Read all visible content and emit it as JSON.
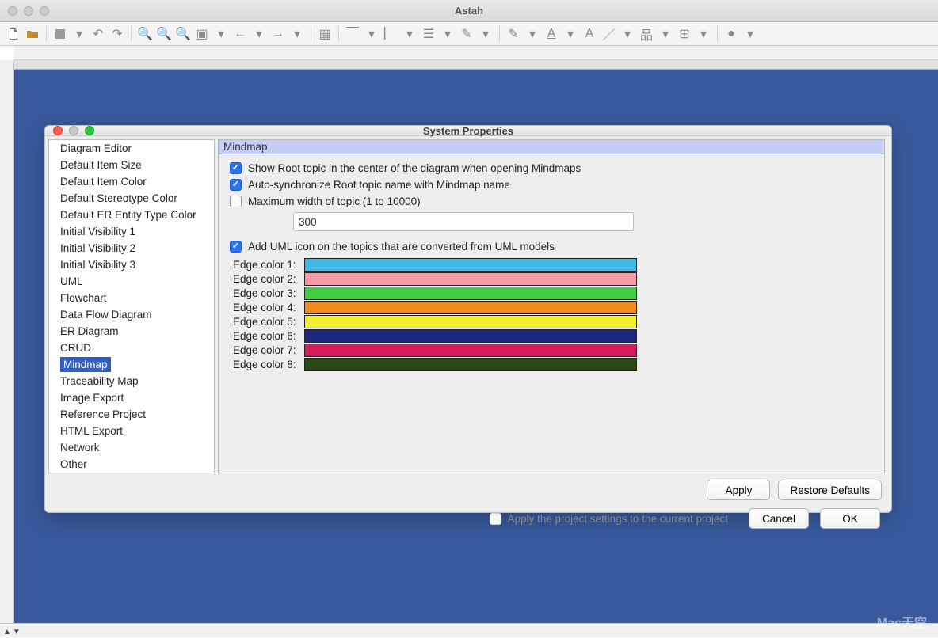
{
  "app": {
    "title": "Astah"
  },
  "dialog": {
    "title": "System Properties",
    "sidebar": {
      "items": [
        "Diagram Editor",
        "Default Item Size",
        "Default Item Color",
        "Default Stereotype Color",
        "Default ER Entity Type Color",
        "Initial Visibility 1",
        "Initial Visibility 2",
        "Initial Visibility 3",
        "UML",
        "Flowchart",
        "Data Flow Diagram",
        "ER Diagram",
        "CRUD",
        "Mindmap",
        "Traceability Map",
        "Image Export",
        "Reference Project",
        "HTML Export",
        "Network",
        "Other"
      ],
      "selected_index": 13
    },
    "content": {
      "header": "Mindmap",
      "opt_show_root": {
        "checked": true,
        "label": "Show Root topic in the center of the diagram when opening Mindmaps"
      },
      "opt_autosync": {
        "checked": true,
        "label": "Auto-synchronize Root topic name with Mindmap name"
      },
      "opt_maxwidth": {
        "checked": false,
        "label": "Maximum width of topic (1 to 10000)",
        "value": "300"
      },
      "opt_umlicon": {
        "checked": true,
        "label": "Add UML icon on the topics that are converted from UML models"
      },
      "edge_colors": [
        {
          "label": "Edge color 1:",
          "color": "#3fb8e8"
        },
        {
          "label": "Edge color 2:",
          "color": "#f59aa4"
        },
        {
          "label": "Edge color 3:",
          "color": "#3fcc3f"
        },
        {
          "label": "Edge color 4:",
          "color": "#f08a1e"
        },
        {
          "label": "Edge color 5:",
          "color": "#f2ef2f"
        },
        {
          "label": "Edge color 6:",
          "color": "#1d267e"
        },
        {
          "label": "Edge color 7:",
          "color": "#d31a5a"
        },
        {
          "label": "Edge color 8:",
          "color": "#2b4915"
        }
      ]
    },
    "buttons": {
      "apply": "Apply",
      "restore": "Restore Defaults"
    },
    "footer": {
      "apply_project_label": "Apply the project settings to the current project",
      "apply_project_checked": false,
      "cancel": "Cancel",
      "ok": "OK"
    }
  },
  "watermark": "Mac天空"
}
